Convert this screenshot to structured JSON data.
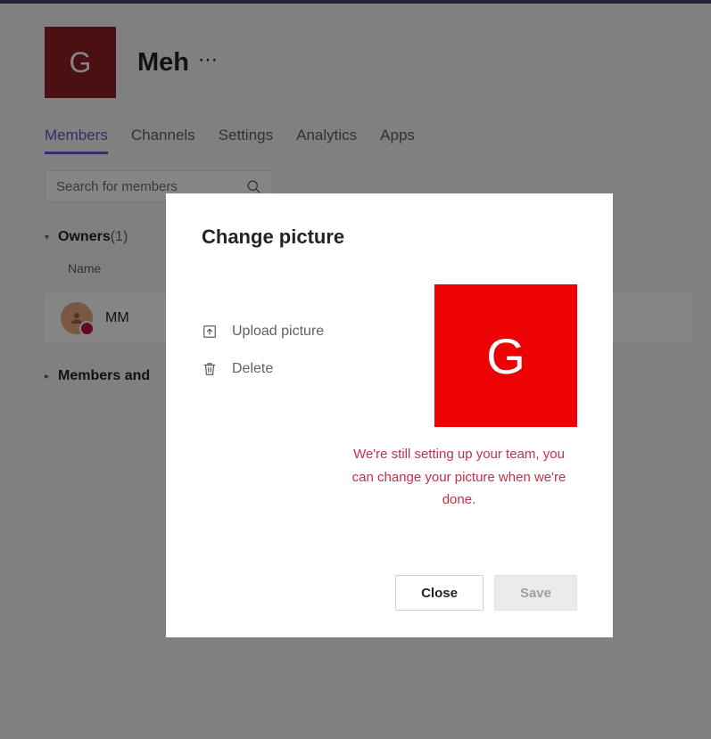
{
  "team": {
    "avatar_letter": "G",
    "name": "Meh"
  },
  "tabs": [
    "Members",
    "Channels",
    "Settings",
    "Analytics",
    "Apps"
  ],
  "search": {
    "placeholder": "Search for members"
  },
  "sections": {
    "owners": {
      "title": "Owners",
      "count": "(1)",
      "col_name": "Name",
      "members": [
        {
          "initials": "MM"
        }
      ]
    },
    "members": {
      "title": "Members and"
    }
  },
  "modal": {
    "title": "Change picture",
    "upload_label": "Upload picture",
    "delete_label": "Delete",
    "preview_letter": "G",
    "warning": "We're still setting up your team, you can change your picture when we're done.",
    "close_label": "Close",
    "save_label": "Save"
  }
}
